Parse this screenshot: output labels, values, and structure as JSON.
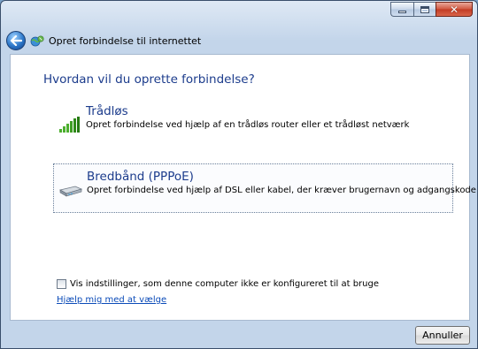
{
  "nav": {
    "back_icon": "back-arrow-icon",
    "app_icon": "network-globe-icon",
    "title": "Opret forbindelse til internettet"
  },
  "window_controls": {
    "minimize_icon": "minimize-icon",
    "maximize_icon": "maximize-icon",
    "close_icon": "close-icon"
  },
  "content": {
    "heading": "Hvordan vil du oprette forbindelse?",
    "options": [
      {
        "icon": "wireless-signal-icon",
        "title": "Trådløs",
        "description": "Opret forbindelse ved hjælp af en trådløs router eller et trådløst netværk",
        "selected": false
      },
      {
        "icon": "broadband-modem-icon",
        "title": "Bredbånd (PPPoE)",
        "description": "Opret forbindelse ved hjælp af DSL eller kabel, der kræver brugernavn og adgangskode",
        "selected": true
      }
    ],
    "checkbox": {
      "label": "Vis indstillinger, som denne computer ikke er konfigureret til at bruge",
      "checked": false
    },
    "help_link": "Hjælp mig med at vælge"
  },
  "footer": {
    "cancel_label": "Annuller"
  },
  "colors": {
    "heading": "#1c3c8c",
    "link": "#0b4bb8",
    "close_button": "#c13a23"
  }
}
